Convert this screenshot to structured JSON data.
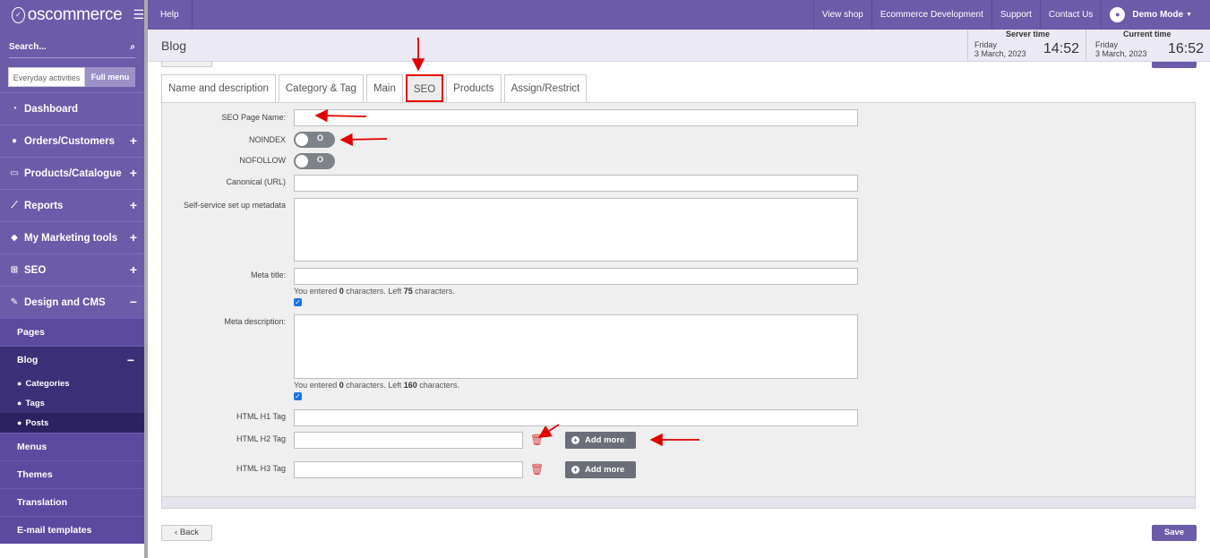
{
  "brand": {
    "name": "oscommerce"
  },
  "sidebar": {
    "search_label": "Search...",
    "mode_tabs": [
      "Everyday activities",
      "Full menu"
    ],
    "items": [
      {
        "label": "Dashboard",
        "icon": "dashboard-icon",
        "toggle": ""
      },
      {
        "label": "Orders/Customers",
        "icon": "users-icon",
        "toggle": "+"
      },
      {
        "label": "Products/Catalogue",
        "icon": "folder-icon",
        "toggle": "+"
      },
      {
        "label": "Reports",
        "icon": "chart-icon",
        "toggle": "+"
      },
      {
        "label": "My Marketing tools",
        "icon": "tag-icon",
        "toggle": "+"
      },
      {
        "label": "SEO",
        "icon": "sitemap-icon",
        "toggle": "+"
      },
      {
        "label": "Design and CMS",
        "icon": "brush-icon",
        "toggle": "−"
      }
    ],
    "design_sub": [
      {
        "label": "Pages"
      },
      {
        "label": "Blog",
        "toggle": "−"
      }
    ],
    "blog_sub": [
      "Categories",
      "Tags",
      "Posts"
    ],
    "design_sub2": [
      "Menus",
      "Themes",
      "Translation",
      "E-mail templates"
    ]
  },
  "topbar": {
    "help": "Help",
    "links": [
      "View shop",
      "Ecommerce Development",
      "Support",
      "Contact Us"
    ],
    "user": "Demo Mode"
  },
  "page": {
    "title": "Blog",
    "server_time": {
      "label": "Server time",
      "day": "Friday",
      "date": "3 March, 2023",
      "time": "14:52"
    },
    "current_time": {
      "label": "Current time",
      "day": "Friday",
      "date": "3 March, 2023",
      "time": "16:52"
    }
  },
  "tabs": [
    "Name and description",
    "Category & Tag",
    "Main",
    "SEO",
    "Products",
    "Assign/Restrict"
  ],
  "active_tab": "SEO",
  "form": {
    "seo_page_name": {
      "label": "SEO Page Name:",
      "value": ""
    },
    "noindex": {
      "label": "NOINDEX",
      "state": "O"
    },
    "nofollow": {
      "label": "NOFOLLOW",
      "state": "O"
    },
    "canonical": {
      "label": "Canonical (URL)",
      "value": ""
    },
    "self_service": {
      "label": "Self-service set up metadata",
      "value": ""
    },
    "meta_title": {
      "label": "Meta title:",
      "hint_a": "You entered ",
      "hint_count": "0",
      "hint_b": " characters. Left ",
      "hint_left": "75",
      "hint_c": " characters."
    },
    "meta_description": {
      "label": "Meta description:",
      "hint_a": "You entered ",
      "hint_count": "0",
      "hint_b": " characters. Left ",
      "hint_left": "160",
      "hint_c": " characters."
    },
    "h1": {
      "label": "HTML H1 Tag"
    },
    "h2": {
      "label": "HTML H2 Tag",
      "add_more": "Add more"
    },
    "h3": {
      "label": "HTML H3 Tag",
      "add_more": "Add more"
    }
  },
  "buttons": {
    "back": "Back",
    "save": "Save"
  },
  "colors": {
    "brand": "#6b5ba9",
    "annotation": "#e00000"
  }
}
